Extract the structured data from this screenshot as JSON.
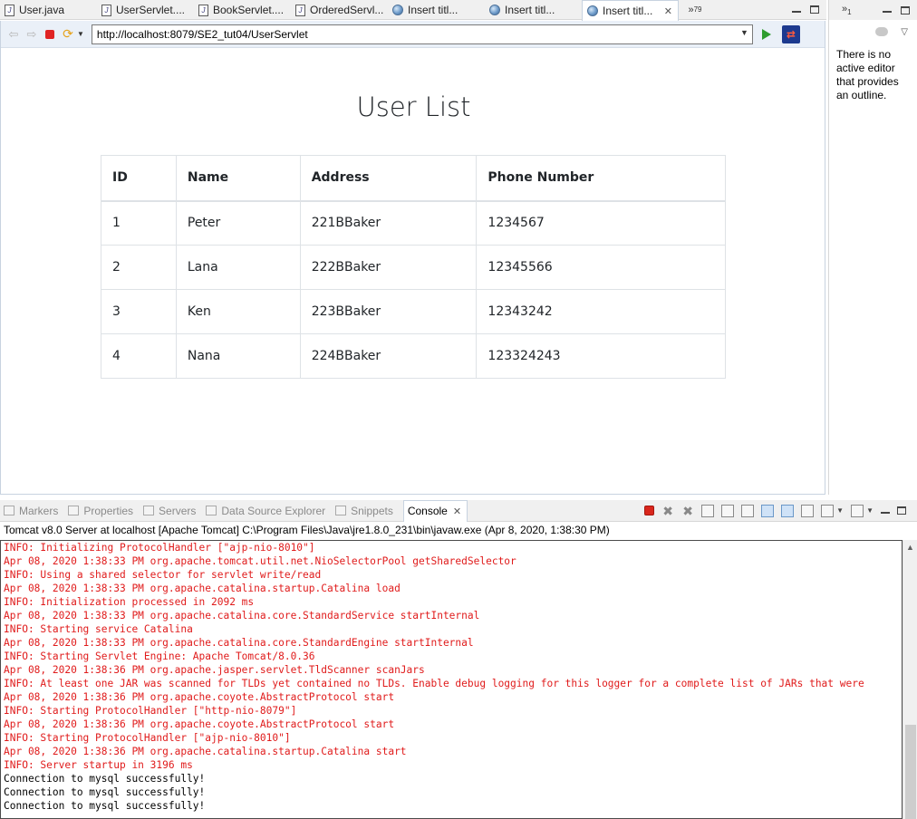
{
  "editor_tabs": [
    {
      "label": "User.java",
      "icon": "java-file-icon",
      "active": false
    },
    {
      "label": "UserServlet....",
      "icon": "java-file-icon",
      "active": false
    },
    {
      "label": "BookServlet....",
      "icon": "java-file-icon",
      "active": false
    },
    {
      "label": "OrderedServl...",
      "icon": "java-file-icon",
      "active": false
    },
    {
      "label": "Insert titl...",
      "icon": "globe-icon",
      "active": false
    },
    {
      "label": "Insert titl...",
      "icon": "globe-icon",
      "active": false
    },
    {
      "label": "Insert titl...",
      "icon": "globe-icon",
      "active": true
    }
  ],
  "tab_overflow": {
    "glyph": "»",
    "count": "79"
  },
  "browser": {
    "url": "http://localhost:8079/SE2_tut04/UserServlet"
  },
  "page": {
    "title": "User List",
    "table": {
      "headers": [
        "ID",
        "Name",
        "Address",
        "Phone Number"
      ],
      "rows": [
        [
          "1",
          "Peter",
          "221BBaker",
          "1234567"
        ],
        [
          "2",
          "Lana",
          "222BBaker",
          "12345566"
        ],
        [
          "3",
          "Ken",
          "223BBaker",
          "12343242"
        ],
        [
          "4",
          "Nana",
          "224BBaker",
          "123324243"
        ]
      ]
    }
  },
  "outline": {
    "overflow_glyph": "»",
    "overflow_count": "1",
    "message": "There is no active editor that provides an outline."
  },
  "view_tabs": [
    {
      "label": "Markers",
      "active": false
    },
    {
      "label": "Properties",
      "active": false
    },
    {
      "label": "Servers",
      "active": false
    },
    {
      "label": "Data Source Explorer",
      "active": false
    },
    {
      "label": "Snippets",
      "active": false
    },
    {
      "label": "Console",
      "active": true
    }
  ],
  "console": {
    "server_line": "Tomcat v8.0 Server at localhost [Apache Tomcat] C:\\Program Files\\Java\\jre1.8.0_231\\bin\\javaw.exe (Apr 8, 2020, 1:38:30 PM)",
    "lines": [
      {
        "text": "INFO: Initializing ProtocolHandler [\"ajp-nio-8010\"]",
        "kind": "err"
      },
      {
        "text": "Apr 08, 2020 1:38:33 PM org.apache.tomcat.util.net.NioSelectorPool getSharedSelector",
        "kind": "err"
      },
      {
        "text": "INFO: Using a shared selector for servlet write/read",
        "kind": "err"
      },
      {
        "text": "Apr 08, 2020 1:38:33 PM org.apache.catalina.startup.Catalina load",
        "kind": "err"
      },
      {
        "text": "INFO: Initialization processed in 2092 ms",
        "kind": "err"
      },
      {
        "text": "Apr 08, 2020 1:38:33 PM org.apache.catalina.core.StandardService startInternal",
        "kind": "err"
      },
      {
        "text": "INFO: Starting service Catalina",
        "kind": "err"
      },
      {
        "text": "Apr 08, 2020 1:38:33 PM org.apache.catalina.core.StandardEngine startInternal",
        "kind": "err"
      },
      {
        "text": "INFO: Starting Servlet Engine: Apache Tomcat/8.0.36",
        "kind": "err"
      },
      {
        "text": "Apr 08, 2020 1:38:36 PM org.apache.jasper.servlet.TldScanner scanJars",
        "kind": "err"
      },
      {
        "text": "INFO: At least one JAR was scanned for TLDs yet contained no TLDs. Enable debug logging for this logger for a complete list of JARs that were",
        "kind": "err"
      },
      {
        "text": "Apr 08, 2020 1:38:36 PM org.apache.coyote.AbstractProtocol start",
        "kind": "err"
      },
      {
        "text": "INFO: Starting ProtocolHandler [\"http-nio-8079\"]",
        "kind": "err"
      },
      {
        "text": "Apr 08, 2020 1:38:36 PM org.apache.coyote.AbstractProtocol start",
        "kind": "err"
      },
      {
        "text": "INFO: Starting ProtocolHandler [\"ajp-nio-8010\"]",
        "kind": "err"
      },
      {
        "text": "Apr 08, 2020 1:38:36 PM org.apache.catalina.startup.Catalina start",
        "kind": "err"
      },
      {
        "text": "INFO: Server startup in 3196 ms",
        "kind": "err"
      },
      {
        "text": "Connection to mysql successfully!",
        "kind": "out"
      },
      {
        "text": "Connection to mysql successfully!",
        "kind": "out"
      },
      {
        "text": "Connection to mysql successfully!",
        "kind": "out"
      }
    ]
  },
  "colors": {
    "console_error": "#e01b1b",
    "console_output": "#000000",
    "stop_red": "#e02424",
    "go_green": "#2e9c2e"
  }
}
